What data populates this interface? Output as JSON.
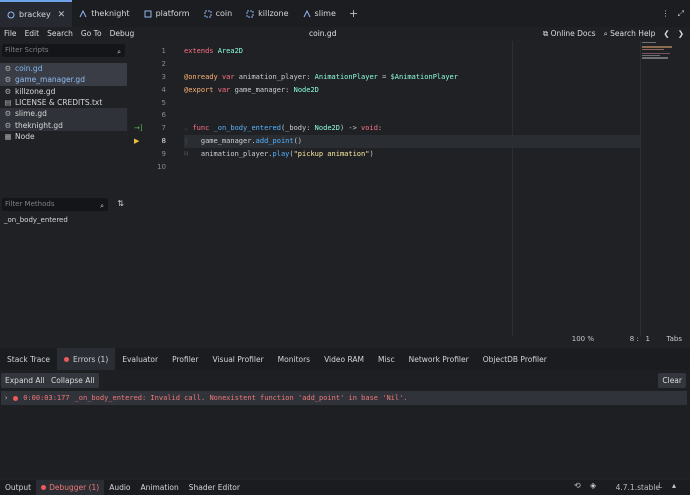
{
  "scene_tabs": [
    {
      "label": "brackey",
      "active": true,
      "closable": true
    },
    {
      "label": "theknight"
    },
    {
      "label": "platform"
    },
    {
      "label": "coin"
    },
    {
      "label": "killzone"
    },
    {
      "label": "slime"
    }
  ],
  "add_tab_icon": "plus-icon",
  "menu": [
    "File",
    "Edit",
    "Search",
    "Go To",
    "Debug"
  ],
  "file_title": "coin.gd",
  "help": {
    "online_docs": "Online Docs",
    "search_help": "Search Help"
  },
  "filter_scripts_placeholder": "Filter Scripts",
  "scripts": [
    {
      "label": "coin.gd",
      "icon": "gear-icon",
      "state": "current"
    },
    {
      "label": "game_manager.gd",
      "icon": "gear-icon",
      "state": "selected"
    },
    {
      "label": "killzone.gd",
      "icon": "gear-icon",
      "state": "normal"
    },
    {
      "label": "LICENSE & CREDITS.txt",
      "icon": "text-file-icon",
      "state": "normal"
    },
    {
      "label": "slime.gd",
      "icon": "gear-icon",
      "state": "hl"
    },
    {
      "label": "theknight.gd",
      "icon": "gear-icon",
      "state": "hl"
    },
    {
      "label": "Node",
      "icon": "node-icon",
      "state": "normal"
    }
  ],
  "filter_methods_placeholder": "Filter Methods",
  "methods": [
    "_on_body_entered"
  ],
  "line_numbers": [
    "1",
    "2",
    "3",
    "4",
    "5",
    "6",
    "7",
    "8",
    "9",
    "10"
  ],
  "code": {
    "l1_kw": "extends",
    "l1_rest": " Area2D",
    "l3_an": "@onready",
    "l3_kw": "var",
    "l3_name": " animation_player: ",
    "l3_type": "AnimationPlayer",
    "l3_eq": " = ",
    "l3_node": "$AnimationPlayer",
    "l4_an": "@export",
    "l4_kw": "var",
    "l4_name": " game_manager: ",
    "l4_type": "Node2D",
    "l7_fold": "⌄ ",
    "l7_kw": "func",
    "l7_fn": " _on_body_entered",
    "l7_args": "(_body: ",
    "l7_type": "Node2D",
    "l7_ret": ") -> ",
    "l7_void": "void",
    "l7_colon": ":",
    "l8_a": "game_manager.",
    "l8_fn": "add_point",
    "l8_b": "()",
    "l9_a": "animation_player.",
    "l9_fn": "play",
    "l9_b": "(",
    "l9_str": "\"pickup animation\"",
    "l9_c": ")"
  },
  "status": {
    "zoom": "100 %",
    "line": "8",
    "col": "1",
    "indent": "Tabs"
  },
  "bottom_tabs": [
    {
      "label": "Stack Trace"
    },
    {
      "label": "Errors (1)",
      "active": true,
      "dot": true
    },
    {
      "label": "Evaluator"
    },
    {
      "label": "Profiler"
    },
    {
      "label": "Visual Profiler"
    },
    {
      "label": "Monitors"
    },
    {
      "label": "Video RAM"
    },
    {
      "label": "Misc"
    },
    {
      "label": "Network Profiler"
    },
    {
      "label": "ObjectDB Profiler"
    }
  ],
  "err_toolbar": {
    "expand": "Expand All",
    "collapse": "Collapse All",
    "clear": "Clear"
  },
  "errors": [
    {
      "time": "0:00:03:177",
      "message": "_on_body_entered: Invalid call. Nonexistent function 'add_point' in base 'Nil'."
    }
  ],
  "dock": [
    {
      "label": "Output"
    },
    {
      "label": "Debugger (1)",
      "active": true,
      "dot": true
    },
    {
      "label": "Audio"
    },
    {
      "label": "Animation"
    },
    {
      "label": "Shader Editor"
    }
  ],
  "version": "4.7.1.stable",
  "colors": {
    "accent": "#6fa3e8",
    "error": "#f07878",
    "keyword": "#ff7085",
    "type": "#8effda",
    "function": "#57b3ff",
    "string": "#ffeda1"
  }
}
